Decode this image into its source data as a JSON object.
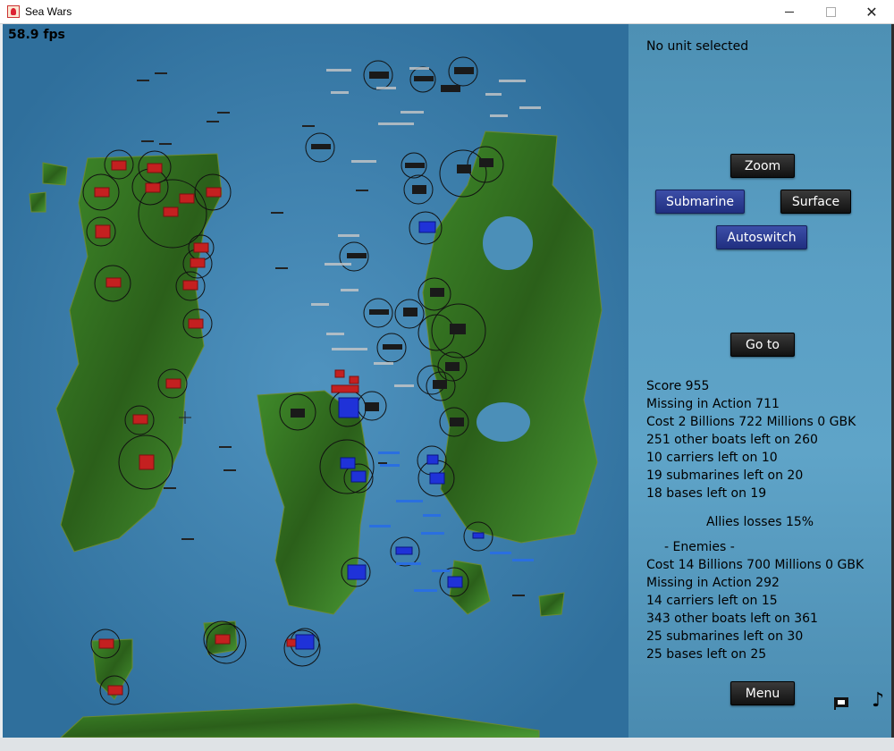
{
  "window": {
    "title": "Sea Wars",
    "minimize": "",
    "maximize": "",
    "close": "✕"
  },
  "hud": {
    "fps": "58.9 fps"
  },
  "panel": {
    "selection": "No unit selected",
    "buttons": {
      "zoom": "Zoom",
      "submarine": "Submarine",
      "surface": "Surface",
      "autoswitch": "Autoswitch",
      "goto": "Go to",
      "menu": "Menu"
    },
    "allies": [
      "Score 955",
      "Missing in Action 711",
      "Cost 2 Billions 722 Millions 0 GBK",
      "251 other boats left on 260",
      "10 carriers left on 10",
      "19 submarines left on 20",
      "18 bases left on 19"
    ],
    "allies_losses": "Allies losses 15%",
    "enemies_header": "- Enemies -",
    "enemies": [
      "Cost 14 Billions 700 Millions 0 GBK",
      "Missing in Action 292",
      "14 carriers left on 15",
      "343 other boats left on 361",
      "25 submarines left on 30",
      "25 bases left on 25"
    ],
    "icons": {
      "flag": "flag-icon",
      "music": "music-note-icon"
    },
    "music_glyph": "♪"
  },
  "colors": {
    "sea": "#2f6f9c",
    "land": "#2f6b1e",
    "enemy": "#c42020",
    "ally": "#1f32d8",
    "neutral": "#222222"
  }
}
